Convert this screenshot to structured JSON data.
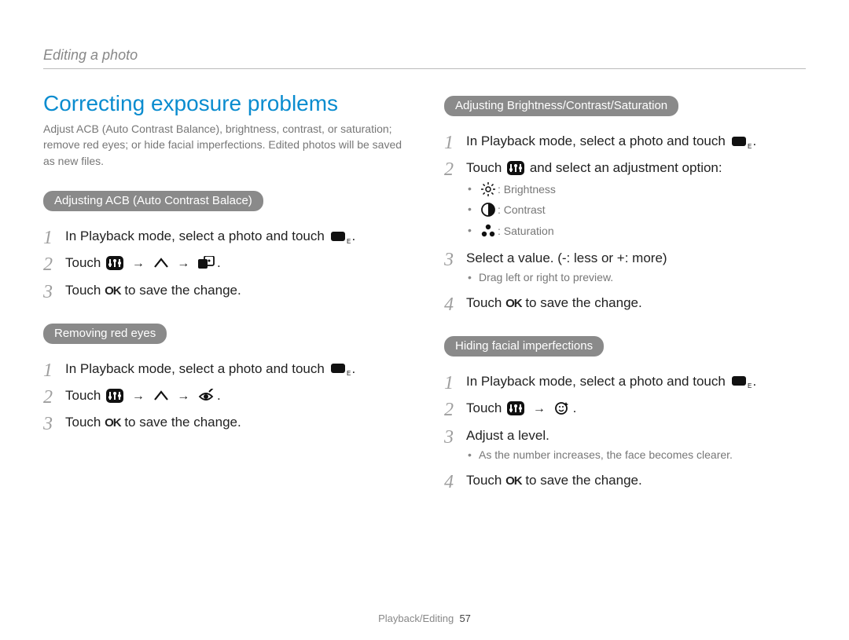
{
  "breadcrumb": "Editing a photo",
  "heading": "Correcting exposure problems",
  "intro": "Adjust ACB (Auto Contrast Balance), brightness, contrast, or saturation; remove red eyes; or hide facial imperfections. Edited photos will be saved as new files.",
  "sections": {
    "acb": {
      "title": "Adjusting ACB (Auto Contrast Balace)",
      "step1_pre": "In Playback mode, select a photo and touch ",
      "step1_post": ".",
      "step2_pre": "Touch ",
      "step2_post": ".",
      "step3_pre": "Touch ",
      "step3_mid": " to save the change."
    },
    "redeye": {
      "title": "Removing red eyes",
      "step1_pre": "In Playback mode, select a photo and touch ",
      "step1_post": ".",
      "step2_pre": "Touch ",
      "step2_post": ".",
      "step3_pre": "Touch ",
      "step3_mid": " to save the change."
    },
    "bcs": {
      "title": "Adjusting Brightness/Contrast/Saturation",
      "step1_pre": "In Playback mode, select a photo and touch ",
      "step1_post": ".",
      "step2_pre": "Touch ",
      "step2_post": " and select an adjustment option:",
      "sub_b": "Brightness",
      "sub_c": "Contrast",
      "sub_s": "Saturation",
      "step3": "Select a value. (-: less or +: more)",
      "sub3": "Drag left or right to preview.",
      "step4_pre": "Touch ",
      "step4_mid": " to save the change."
    },
    "face": {
      "title": "Hiding facial imperfections",
      "step1_pre": "In Playback mode, select a photo and touch ",
      "step1_post": ".",
      "step2_pre": "Touch ",
      "step2_post": ".",
      "step3": "Adjust a level.",
      "sub3": "As the number increases, the face becomes clearer.",
      "step4_pre": "Touch ",
      "step4_mid": " to save the change."
    }
  },
  "icons": {
    "edit": "edit-icon",
    "adjust": "adjust-icon",
    "caret_up": "caret-up-icon",
    "acb": "acb-icon",
    "redeye": "redeye-icon",
    "brightness": "brightness-icon",
    "contrast": "contrast-icon",
    "saturation": "saturation-icon",
    "face_retouch": "face-retouch-icon",
    "ok": "OK"
  },
  "footer": {
    "section": "Playback/Editing",
    "page": "57"
  }
}
